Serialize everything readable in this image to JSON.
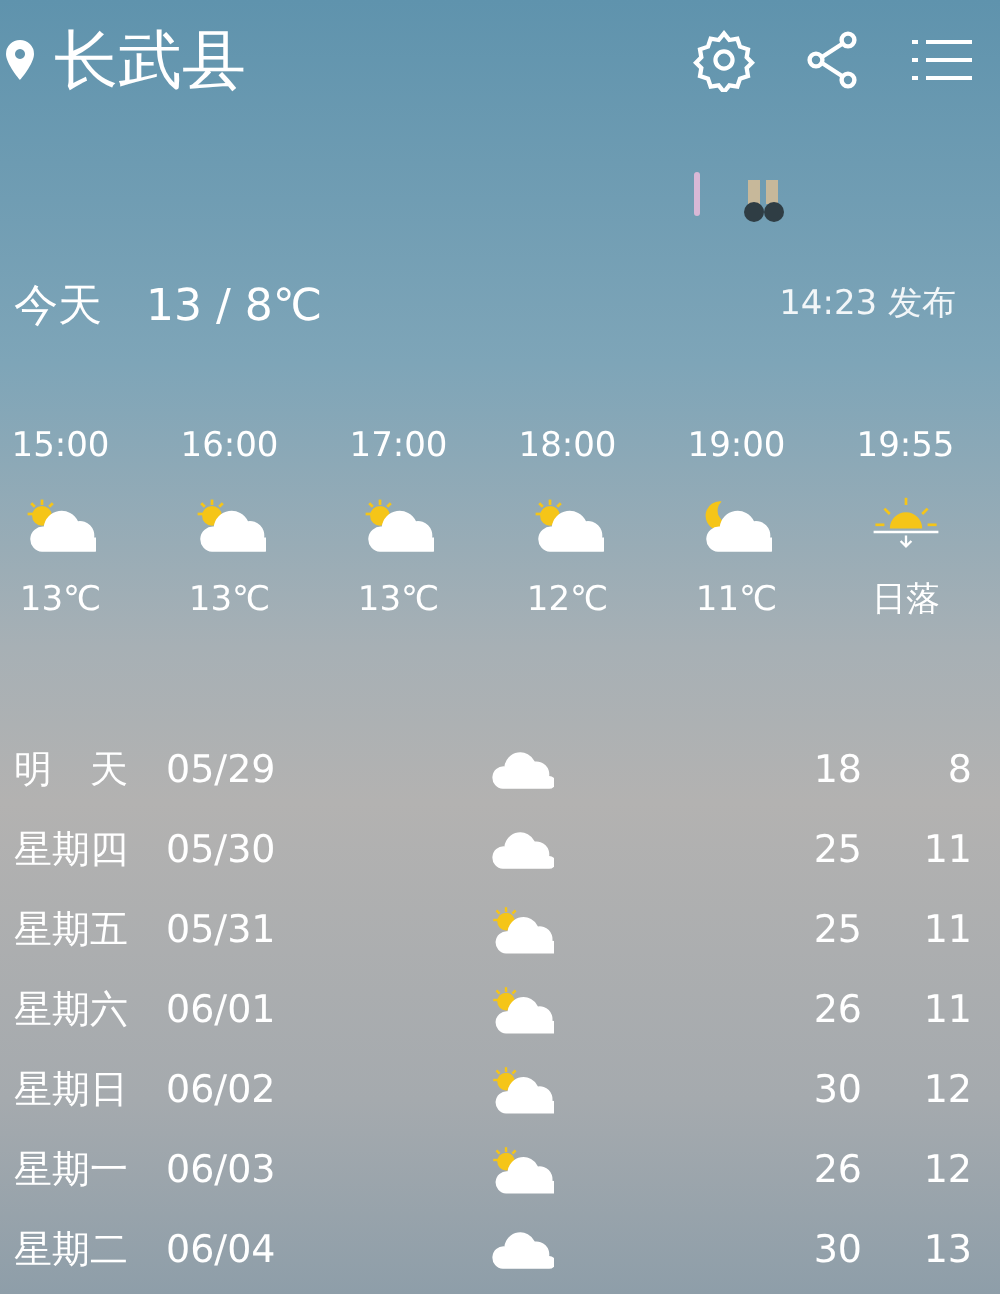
{
  "header": {
    "city": "长武县"
  },
  "today": {
    "label": "今天",
    "temps": "13 / 8℃",
    "published": "14:23 发布"
  },
  "hourly": [
    {
      "time": "15:00",
      "kind": "partly_cloudy_day",
      "temp": "13℃"
    },
    {
      "time": "16:00",
      "kind": "partly_cloudy_day",
      "temp": "13℃"
    },
    {
      "time": "17:00",
      "kind": "partly_cloudy_day",
      "temp": "13℃"
    },
    {
      "time": "18:00",
      "kind": "partly_cloudy_day",
      "temp": "12℃"
    },
    {
      "time": "19:00",
      "kind": "partly_cloudy_night",
      "temp": "11℃"
    },
    {
      "time": "19:55",
      "kind": "sunset",
      "temp": "日落"
    }
  ],
  "daily": [
    {
      "day": "明　天",
      "date": "05/29",
      "kind": "cloudy",
      "high": "18",
      "low": "8"
    },
    {
      "day": "星期四",
      "date": "05/30",
      "kind": "cloudy",
      "high": "25",
      "low": "11"
    },
    {
      "day": "星期五",
      "date": "05/31",
      "kind": "partly_cloudy_day",
      "high": "25",
      "low": "11"
    },
    {
      "day": "星期六",
      "date": "06/01",
      "kind": "partly_cloudy_day",
      "high": "26",
      "low": "11"
    },
    {
      "day": "星期日",
      "date": "06/02",
      "kind": "partly_cloudy_day",
      "high": "30",
      "low": "12"
    },
    {
      "day": "星期一",
      "date": "06/03",
      "kind": "partly_cloudy_day",
      "high": "26",
      "low": "12"
    },
    {
      "day": "星期二",
      "date": "06/04",
      "kind": "cloudy",
      "high": "30",
      "low": "13"
    }
  ]
}
